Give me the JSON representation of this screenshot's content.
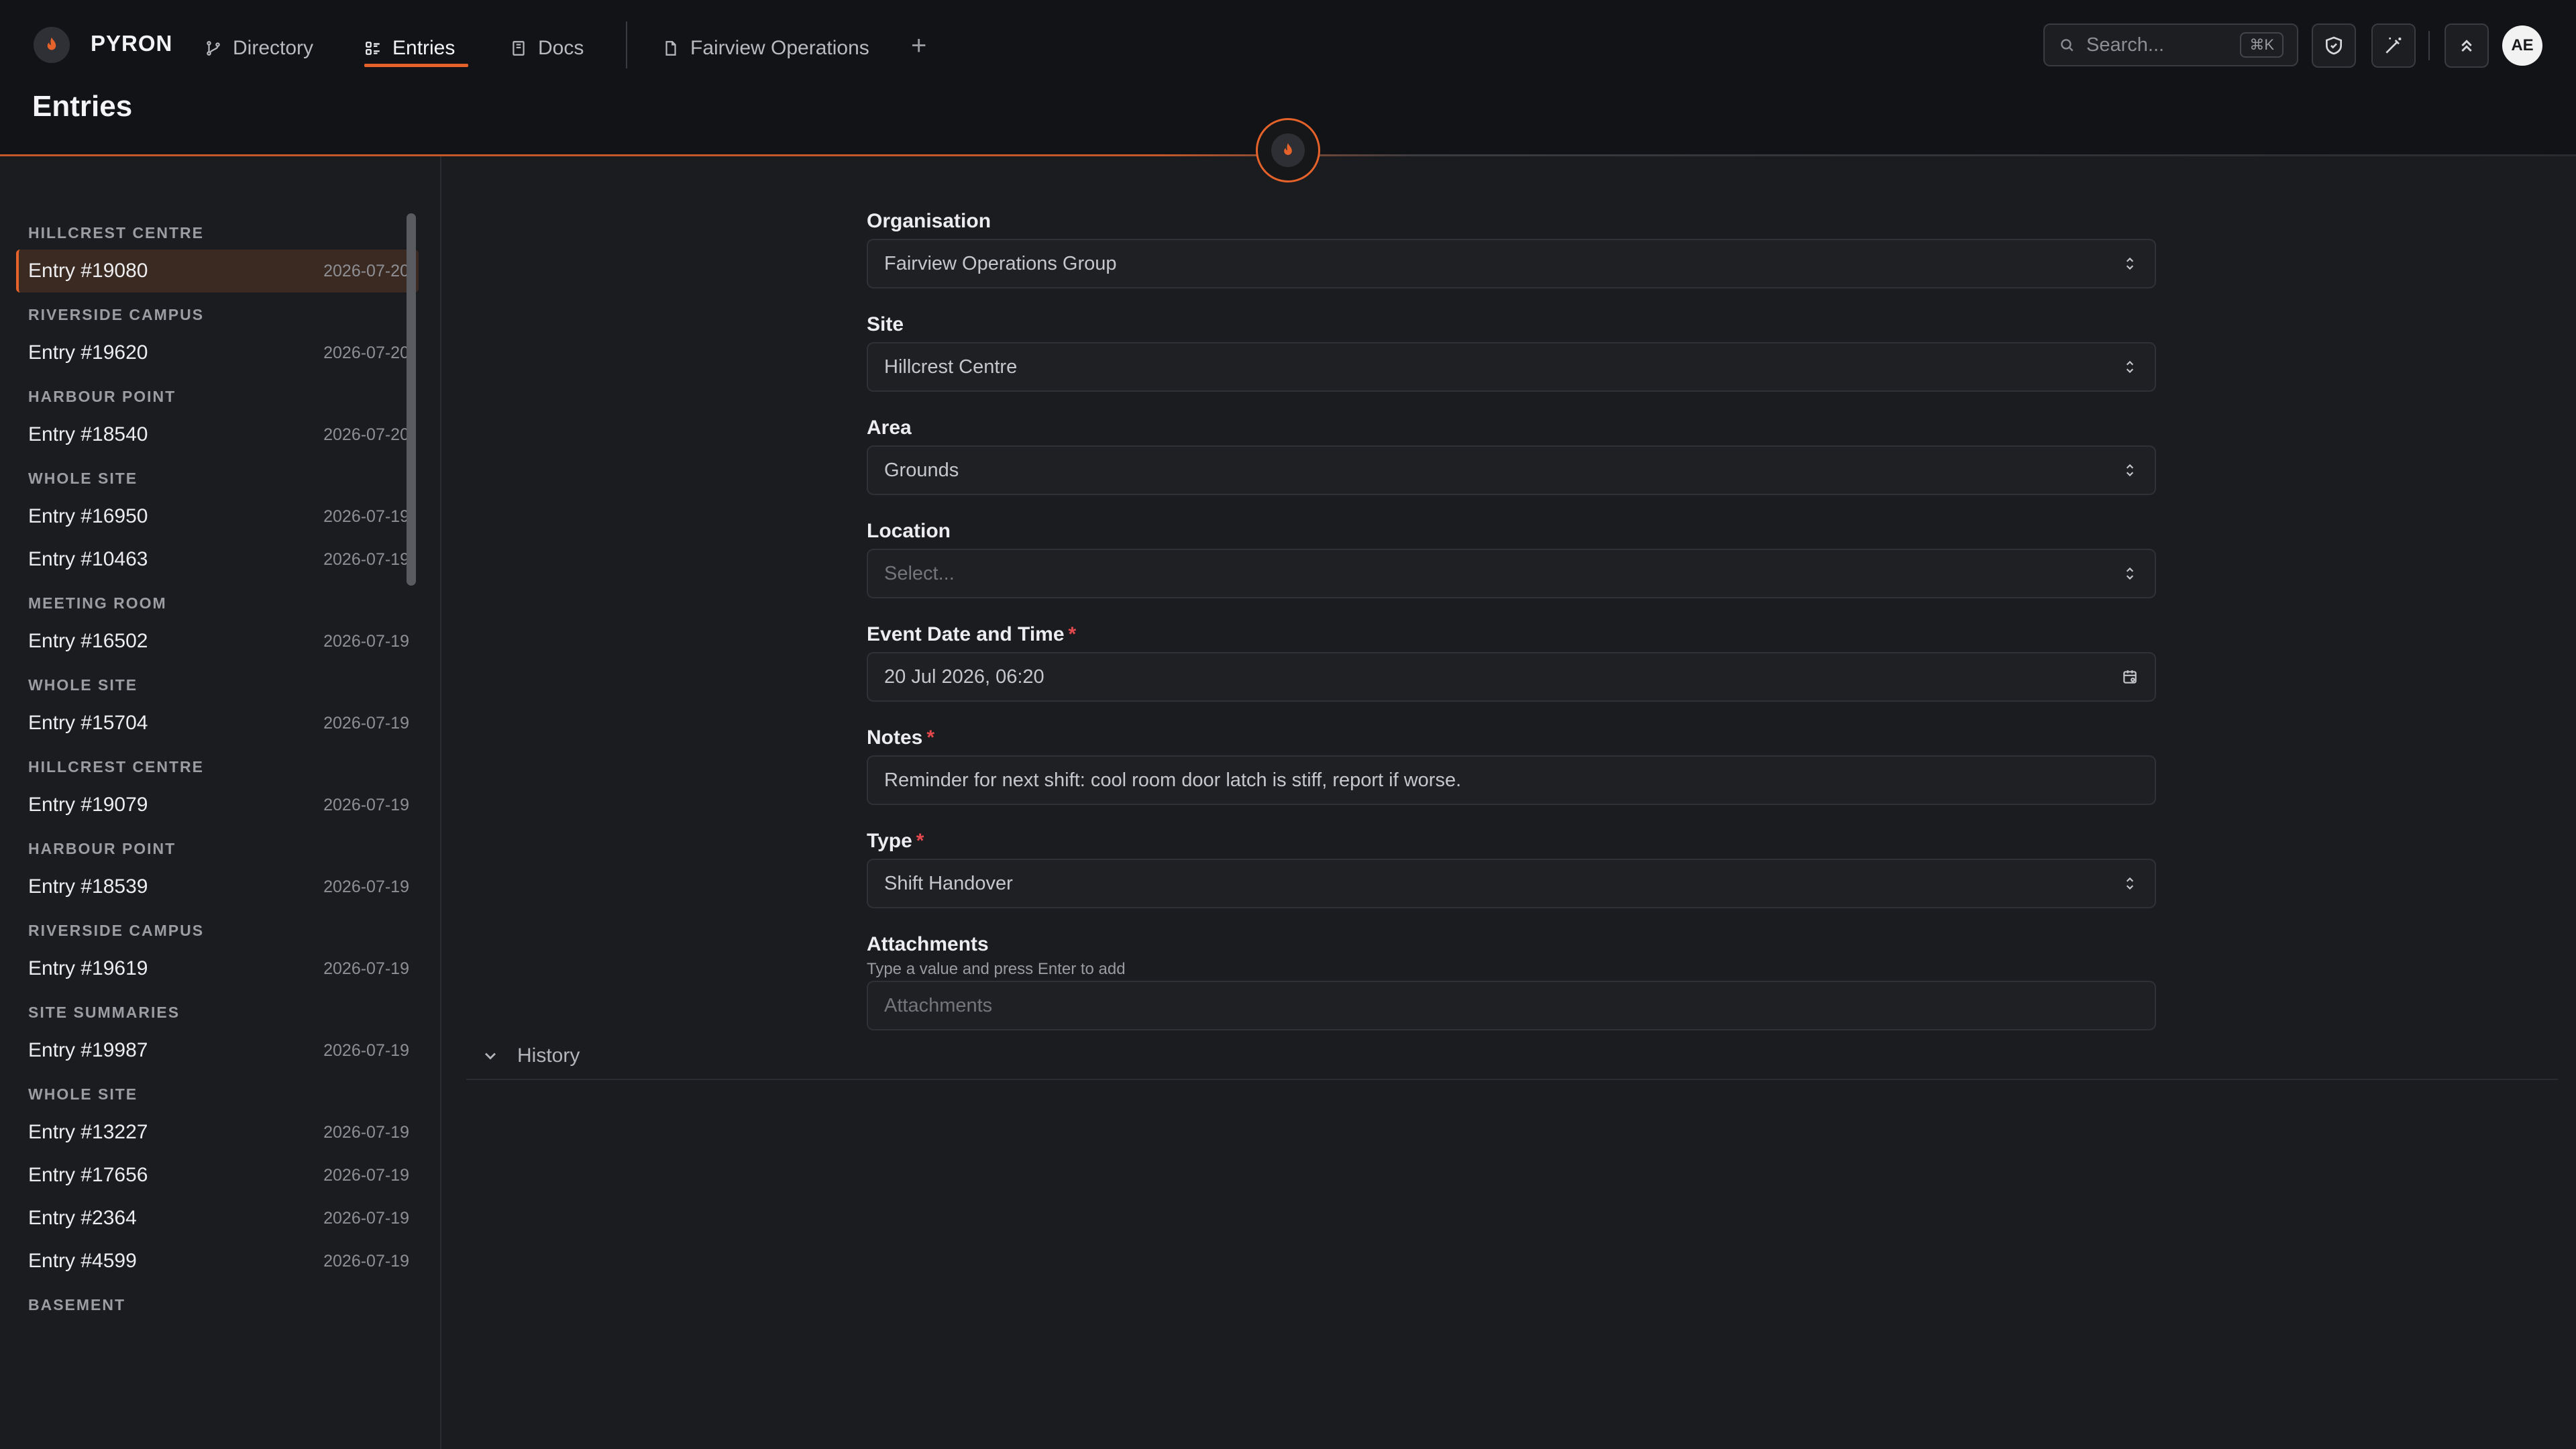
{
  "app": {
    "brand": "PYRON",
    "page_title": "Entries"
  },
  "nav": {
    "tabs": [
      {
        "label": "Directory",
        "icon": "git-branch-icon"
      },
      {
        "label": "Entries",
        "icon": "list-icon",
        "active": true
      },
      {
        "label": "Docs",
        "icon": "book-icon"
      }
    ],
    "open_doc": {
      "label": "Fairview Operations",
      "icon": "file-icon"
    },
    "add_tab": "+"
  },
  "topbar": {
    "search_placeholder": "Search...",
    "search_shortcut": "⌘K",
    "avatar_initials": "AE"
  },
  "colors": {
    "accent": "#e5632a",
    "required": "#e5484d",
    "background": "#1b1c20"
  },
  "sidebar": {
    "groups": [
      {
        "label": "HILLCREST CENTRE",
        "entries": [
          {
            "label": "Entry #19080",
            "date": "2026-07-20",
            "selected": true
          }
        ]
      },
      {
        "label": "RIVERSIDE CAMPUS",
        "entries": [
          {
            "label": "Entry #19620",
            "date": "2026-07-20"
          }
        ]
      },
      {
        "label": "HARBOUR POINT",
        "entries": [
          {
            "label": "Entry #18540",
            "date": "2026-07-20"
          }
        ]
      },
      {
        "label": "WHOLE SITE",
        "entries": [
          {
            "label": "Entry #16950",
            "date": "2026-07-19"
          },
          {
            "label": "Entry #10463",
            "date": "2026-07-19"
          }
        ]
      },
      {
        "label": "MEETING ROOM",
        "entries": [
          {
            "label": "Entry #16502",
            "date": "2026-07-19"
          }
        ]
      },
      {
        "label": "WHOLE SITE",
        "entries": [
          {
            "label": "Entry #15704",
            "date": "2026-07-19"
          }
        ]
      },
      {
        "label": "HILLCREST CENTRE",
        "entries": [
          {
            "label": "Entry #19079",
            "date": "2026-07-19"
          }
        ]
      },
      {
        "label": "HARBOUR POINT",
        "entries": [
          {
            "label": "Entry #18539",
            "date": "2026-07-19"
          }
        ]
      },
      {
        "label": "RIVERSIDE CAMPUS",
        "entries": [
          {
            "label": "Entry #19619",
            "date": "2026-07-19"
          }
        ]
      },
      {
        "label": "SITE SUMMARIES",
        "entries": [
          {
            "label": "Entry #19987",
            "date": "2026-07-19"
          }
        ]
      },
      {
        "label": "WHOLE SITE",
        "entries": [
          {
            "label": "Entry #13227",
            "date": "2026-07-19"
          },
          {
            "label": "Entry #17656",
            "date": "2026-07-19"
          },
          {
            "label": "Entry #2364",
            "date": "2026-07-19"
          },
          {
            "label": "Entry #4599",
            "date": "2026-07-19"
          }
        ]
      },
      {
        "label": "BASEMENT",
        "entries": []
      }
    ]
  },
  "form": {
    "organisation": {
      "label": "Organisation",
      "value": "Fairview Operations Group"
    },
    "site": {
      "label": "Site",
      "value": "Hillcrest Centre"
    },
    "area": {
      "label": "Area",
      "value": "Grounds"
    },
    "location": {
      "label": "Location",
      "placeholder": "Select..."
    },
    "event_datetime": {
      "label": "Event Date and Time",
      "value": "20 Jul 2026, 06:20",
      "required_mark": "*"
    },
    "notes": {
      "label": "Notes",
      "value": "Reminder for next shift: cool room door latch is stiff, report if worse.",
      "required_mark": "*"
    },
    "type": {
      "label": "Type",
      "value": "Shift Handover",
      "required_mark": "*"
    },
    "attachments": {
      "label": "Attachments",
      "hint": "Type a value and press Enter to add",
      "placeholder": "Attachments"
    }
  },
  "history": {
    "label": "History"
  }
}
